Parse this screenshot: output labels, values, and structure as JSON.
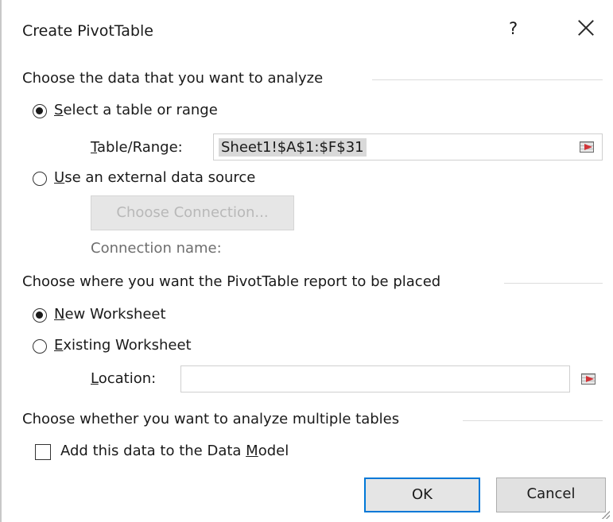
{
  "dialog": {
    "title": "Create PivotTable",
    "help_glyph": "?"
  },
  "section_data": {
    "heading": "Choose the data that you want to analyze",
    "select_range": {
      "label_u": "S",
      "label_rest": "elect a table or range",
      "checked": true
    },
    "table_range": {
      "label_u": "T",
      "label_rest": "able/Range:",
      "value": "Sheet1!$A$1:$F$31"
    },
    "external": {
      "label_u": "U",
      "label_rest": "se an external data source",
      "checked": false
    },
    "choose_connection": "Choose Connection...",
    "connection_name": "Connection name:"
  },
  "section_place": {
    "heading": "Choose where you want the PivotTable report to be placed",
    "new_ws": {
      "label_u": "N",
      "label_rest": "ew Worksheet",
      "checked": true
    },
    "existing_ws": {
      "label_u": "E",
      "label_rest": "xisting Worksheet",
      "checked": false
    },
    "location": {
      "label_u": "L",
      "label_rest": "ocation:",
      "value": ""
    }
  },
  "section_model": {
    "heading": "Choose whether you want to analyze multiple tables",
    "checkbox": {
      "label_pre": "Add this data to the Data ",
      "label_u": "M",
      "label_rest": "odel",
      "checked": false
    }
  },
  "buttons": {
    "ok": "OK",
    "cancel": "Cancel"
  },
  "colors": {
    "accent": "#0078d7",
    "collapse_arrow": "#d13438"
  },
  "icons": {
    "close": "close-icon",
    "collapse_dialog": "collapse-dialog-icon"
  }
}
